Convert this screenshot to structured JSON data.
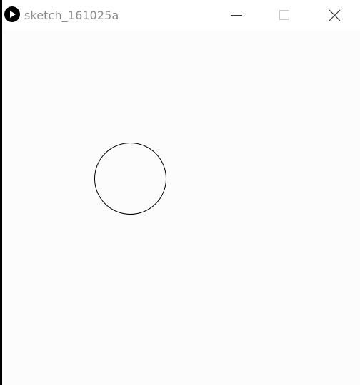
{
  "window": {
    "title": "sketch_161025a",
    "icon": "processing-play-icon",
    "controls": {
      "minimize_icon": "minimize-icon",
      "maximize_icon": "maximize-icon",
      "close_icon": "close-icon"
    }
  },
  "canvas": {
    "background": "#fcfcfc",
    "shapes": [
      {
        "type": "circle",
        "stroke": "#000000",
        "fill": "none"
      }
    ]
  }
}
